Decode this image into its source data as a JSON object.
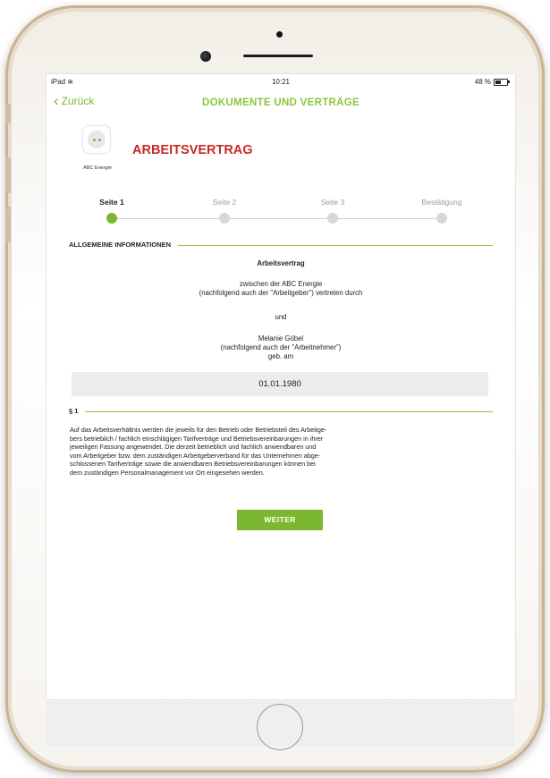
{
  "status_bar": {
    "device": "iPad",
    "time": "10:21",
    "battery": "48 %",
    "battery_level": 0.48
  },
  "nav": {
    "back_label": "Zurück",
    "title": "DOKUMENTE UND VERTRÄGE"
  },
  "header": {
    "logo_text": "ABC Energie",
    "document_title": "ARBEITSVERTRAG"
  },
  "steps": [
    {
      "label": "Seite 1",
      "active": true
    },
    {
      "label": "Seite 2",
      "active": false
    },
    {
      "label": "Seite 3",
      "active": false
    },
    {
      "label": "Bestätigung",
      "active": false
    }
  ],
  "sections": {
    "general": "ALLGEMEINE INFORMATIONEN",
    "paragraph": "§ 1"
  },
  "contract": {
    "heading": "Arbeitsvertrag",
    "between_line1": "zwischen der ABC Energie",
    "between_line2": "(nachfolgend auch der \"Arbeitgeber\") vertreten durch",
    "and": "und",
    "employee_name": "Melanie Göbel",
    "employee_line2": "(nachfolgend auch der \"Arbeitnehmer\")",
    "born": "geb. am",
    "birth_date": "01.01.1980"
  },
  "paragraph_lines": [
    "Auf das Arbeitsverhältnis werden die jeweils für den Betrieb oder Betriebsteil des Arbeitge-",
    "bers betrieblich / fachlich einschlägigen Tarifverträge und Betriebsvereinbarungen in ihrer",
    "jeweiligen Fassung angewendet. Die derzeit betrieblich und fachlich anwendbaren und",
    "vom Arbeitgeber bzw. dem zuständigen Arbeitgeberverband für das Unternehmen abge-",
    "schlossenen Tarifverträge sowie die anwendbaren Betriebsvereinbarungen können bei",
    "dem zuständigen Personalmanagement vor Ort eingesehen werden."
  ],
  "button": {
    "next_label": "WEITER"
  },
  "colors": {
    "accent": "#7cb82f",
    "title_red": "#c52a2a",
    "nav_title": "#8cc63f"
  }
}
